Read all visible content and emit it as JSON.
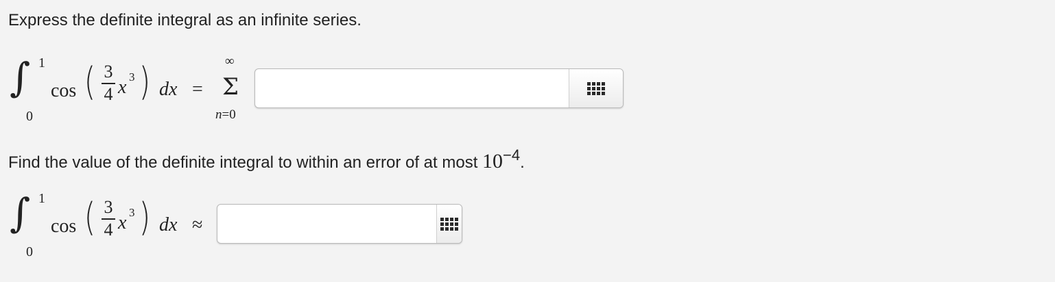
{
  "prompt_1": "Express the definite integral as an infinite series.",
  "integral": {
    "lower_limit": "0",
    "upper_limit": "1",
    "function_name": "cos",
    "coefficient_numerator": "3",
    "coefficient_denominator": "4",
    "variable": "x",
    "exponent": "3",
    "differential_d": "d",
    "differential_var": "x"
  },
  "series": {
    "relation": "=",
    "sum_upper": "∞",
    "sum_symbol": "Σ",
    "sum_index": "n",
    "sum_index_eq": "=0"
  },
  "answer_1": {
    "value": "",
    "placeholder": ""
  },
  "prompt_2": {
    "text": "Find the value of the definite integral to within an error of at most ",
    "base": "10",
    "exponent": "−4",
    "end": "."
  },
  "approx": {
    "relation": "≈"
  },
  "answer_2": {
    "value": "",
    "placeholder": ""
  },
  "icons": {
    "palette": "math-palette-grid-icon"
  }
}
